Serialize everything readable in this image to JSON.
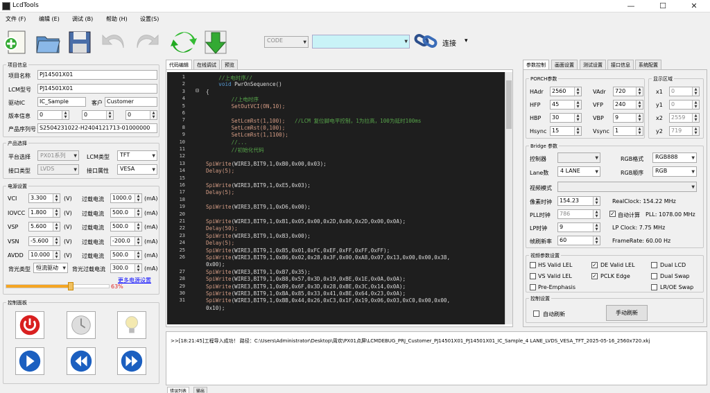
{
  "window": {
    "title": "LcdTools",
    "minimize": "—",
    "maximize": "☐",
    "close": "✕"
  },
  "menu": [
    "文件 (F)",
    "编辑 (E)",
    "调试 (B)",
    "帮助 (H)",
    "设置(S)"
  ],
  "toolbar": {
    "code_select": "CODE",
    "port_select": "",
    "connect_label": "连接",
    "connect_arrow": "▾"
  },
  "left": {
    "project": {
      "title": "项目信息",
      "name_label": "项目名称",
      "name": "PJ14501X01",
      "lcm_label": "LCM型号",
      "lcm": "PJ14501X01",
      "ic_label": "驱动IC",
      "ic": "IC_Sample",
      "customer_label": "客户",
      "customer": "Customer",
      "version_label": "版本信息",
      "v1": "0",
      "v2": "0",
      "v3": "0",
      "serial_label": "产品序列号",
      "serial": "S2504231022-H2404121713-01000000"
    },
    "product": {
      "title": "产品选择",
      "platform_label": "平台选择",
      "platform": "PX01系列",
      "lcmtype_label": "LCM类型",
      "lcmtype": "TFT",
      "iface_label": "接口类型",
      "iface": "LVDS",
      "iface_attr_label": "接口属性",
      "iface_attr": "VESA"
    },
    "power": {
      "title": "电源设置",
      "overcurrent_label": "过载电流",
      "unit_v": "(V)",
      "unit_ma": "(mA)",
      "rows": [
        {
          "name": "VCI",
          "v": "3.300",
          "ma": "1000.0"
        },
        {
          "name": "IOVCC",
          "v": "1.800",
          "ma": "500.0"
        },
        {
          "name": "VSP",
          "v": "5.600",
          "ma": "500.0"
        },
        {
          "name": "VSN",
          "v": "-5.600",
          "ma": "-200.0"
        },
        {
          "name": "AVDD",
          "v": "10.000",
          "ma": "500.0"
        }
      ],
      "backlight_type_label": "背光类型",
      "backlight_type": "恒流驱动",
      "backlight_oc_label": "背光过载电流",
      "backlight_oc": "300.0",
      "more_link": "更多电源设置",
      "progress_text": "63%",
      "progress": 0.63
    },
    "control": {
      "title": "控制面板"
    }
  },
  "editor": {
    "tabs": [
      "代码编辑",
      "在线调试",
      "预览"
    ],
    "lines": [
      {
        "n": "1",
        "t": "    //上电时序//",
        "k": "c"
      },
      {
        "n": "2",
        "t": "    void PwrOnSequence()",
        "k": "k"
      },
      {
        "n": "3",
        "t": "{",
        "k": ""
      },
      {
        "n": "4",
        "t": "        //上电时序",
        "k": "c"
      },
      {
        "n": "5",
        "t": "        SetOutVCI(ON,10);",
        "k": "f"
      },
      {
        "n": "6",
        "t": "",
        "k": ""
      },
      {
        "n": "7",
        "t": "        SetLcmRst(1,100);   //LCM 复位脚电平控制，1为拉高，100为延时100ms",
        "k": "fc"
      },
      {
        "n": "8",
        "t": "        SetLcmRst(0,100);",
        "k": "f"
      },
      {
        "n": "9",
        "t": "        SetLcmRst(1,1100);",
        "k": "f"
      },
      {
        "n": "10",
        "t": "        //...",
        "k": "c"
      },
      {
        "n": "11",
        "t": "        //初始化代码",
        "k": "c"
      },
      {
        "n": "12",
        "t": "",
        "k": ""
      },
      {
        "n": "13",
        "t": "SpiWrite(WIRE3,BIT9,1,0xB0,0x00,0x03);",
        "k": "s"
      },
      {
        "n": "14",
        "t": "Delay(5);",
        "k": "f"
      },
      {
        "n": "15",
        "t": "",
        "k": ""
      },
      {
        "n": "16",
        "t": "SpiWrite(WIRE3,BIT9,1,0xE5,0x03);",
        "k": "s"
      },
      {
        "n": "17",
        "t": "Delay(5);",
        "k": "f"
      },
      {
        "n": "18",
        "t": "",
        "k": ""
      },
      {
        "n": "19",
        "t": "SpiWrite(WIRE3,BIT9,1,0xD6,0x00);",
        "k": "s"
      },
      {
        "n": "20",
        "t": "",
        "k": ""
      },
      {
        "n": "21",
        "t": "SpiWrite(WIRE3,BIT9,1,0xB1,0x05,0x00,0x2D,0x00,0x2D,0x00,0x0A);",
        "k": "s"
      },
      {
        "n": "22",
        "t": "Delay(50);",
        "k": "f"
      },
      {
        "n": "23",
        "t": "SpiWrite(WIRE3,BIT9,1,0xB3,0x00);",
        "k": "s"
      },
      {
        "n": "24",
        "t": "Delay(5);",
        "k": "f"
      },
      {
        "n": "25",
        "t": "SpiWrite(WIRE3,BIT9,1,0xB5,0x01,0xFC,0xEF,0xFF,0xFF,0xFF);",
        "k": "s"
      },
      {
        "n": "26",
        "t": "SpiWrite(WIRE3,BIT9,1,0xB6,0x02,0x28,0x3F,0x00,0xA8,0x07,0x13,0x00,0x00,0x38,",
        "k": "s"
      },
      {
        "n": "",
        "t": "0x00);",
        "k": "s"
      },
      {
        "n": "27",
        "t": "SpiWrite(WIRE3,BIT9,1,0xB7,0x35);",
        "k": "s"
      },
      {
        "n": "28",
        "t": "SpiWrite(WIRE3,BIT9,1,0xB8,0x57,0x3D,0x19,0xBE,0x1E,0x0A,0x0A);",
        "k": "s"
      },
      {
        "n": "29",
        "t": "SpiWrite(WIRE3,BIT9,1,0xB9,0x6F,0x3D,0x28,0xBE,0x3C,0x14,0x0A);",
        "k": "s"
      },
      {
        "n": "30",
        "t": "SpiWrite(WIRE3,BIT9,1,0xBA,0x85,0x33,0x41,0xBE,0x64,0x23,0x0A);",
        "k": "s"
      },
      {
        "n": "31",
        "t": "SpiWrite(WIRE3,BIT9,1,0xBB,0x44,0x26,0xC3,0x1F,0x19,0x06,0x03,0xC0,0x00,0x00,",
        "k": "s"
      },
      {
        "n": "",
        "t": "0x10);",
        "k": "s"
      }
    ]
  },
  "log": {
    "text": ">>[18:21:45]工程导入成功！ 路径：C:\\Users\\Administrator\\Desktop\\周欢\\PX01点屏\\LCMDEBUG_PRJ_Customer_PJ14501X01_PJ14501X01_IC_Sample_4 LANE_LVDS_VESA_TFT_2025-05-16_2560x720.xkj",
    "bottom_tabs": [
      "错误列表",
      "输出"
    ]
  },
  "right": {
    "tabs": [
      "参数控制",
      "画面设置",
      "测试设置",
      "接口信息",
      "系统配置"
    ],
    "porch": {
      "title": "PORCH参数",
      "had_label": "HAdr",
      "had": "2560",
      "hfp_label": "HFP",
      "hfp": "45",
      "hbp_label": "HBP",
      "hbp": "30",
      "hsync_label": "Hsync",
      "hsync": "15",
      "vad_label": "VAdr",
      "vad": "720",
      "vfp_label": "VFP",
      "vfp": "240",
      "vbp_label": "VBP",
      "vbp": "9",
      "vsync_label": "Vsync",
      "vsync": "1"
    },
    "display": {
      "title": "显示区域",
      "x1_label": "x1",
      "x1": "0",
      "y1_label": "y1",
      "y1": "0",
      "x2_label": "x2",
      "x2": "2559",
      "y2_label": "y2",
      "y2": "719"
    },
    "bridge": {
      "title": "Bridge 参数",
      "ctrl_label": "控制器",
      "ctrl": "",
      "rgbfmt_label": "RGB格式",
      "rgbfmt": "RGB888",
      "lane_label": "Lane数",
      "lane": "4 LANE",
      "rgborder_label": "RGB顺序",
      "rgborder": "RGB",
      "video_label": "视频模式",
      "video": "",
      "pclk_label": "像素时钟",
      "pclk": "154.23",
      "realclk": "RealClock: 154.22 MHz",
      "pll_label": "PLL时钟",
      "pll": "786",
      "autocalc_label": "自动计算",
      "pllval": "PLL: 1078.00 MHz",
      "lp_label": "LP时钟",
      "lp": "9",
      "lpclk": "LP Clock: 7.75 MHz",
      "fps_label": "帧刷新率",
      "fps": "60",
      "framerate": "FrameRate: 60.00 Hz"
    },
    "video": {
      "title": "视频参数设置",
      "hs": "HS Valid LEL",
      "de": "DE Valid LEL",
      "dual": "Dual LCD",
      "vs": "VS Valid LEL",
      "pclk": "PCLK Edge",
      "dualswap": "Dual Swap",
      "pre": "Pre-Emphasis",
      "lroe": "LR/OE Swap",
      "hs_c": false,
      "de_c": true,
      "dual_c": false,
      "vs_c": false,
      "pclk_c": true,
      "dualswap_c": false,
      "pre_c": false,
      "lroe_c": false
    },
    "ctrl": {
      "title": "控制设置",
      "auto_label": "自动刷新",
      "manual_btn": "手动刷新"
    }
  }
}
